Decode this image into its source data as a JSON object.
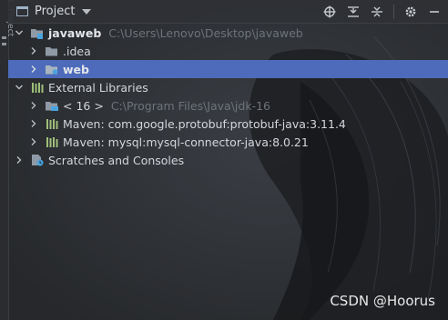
{
  "side_panel": {
    "label": "1: Project"
  },
  "toolbar": {
    "title": "Project",
    "icons": [
      "locate-icon",
      "expand-all-icon",
      "collapse-all-icon",
      "gear-icon",
      "minimize-icon"
    ]
  },
  "tree": {
    "project_root": {
      "name": "javaweb",
      "path": "C:\\Users\\Lenovo\\Desktop\\javaweb"
    },
    "idea_folder": {
      "name": ".idea"
    },
    "web_folder": {
      "name": "web"
    },
    "external_libraries": {
      "name": "External Libraries"
    },
    "jdk": {
      "name": "< 16 >",
      "path": "C:\\Program Files\\Java\\jdk-16"
    },
    "maven_protobuf": {
      "name": "Maven: com.google.protobuf:protobuf-java:3.11.4"
    },
    "maven_mysql": {
      "name": "Maven: mysql:mysql-connector-java:8.0.21"
    },
    "scratches": {
      "name": "Scratches and Consoles"
    }
  },
  "watermark": "CSDN @Hoorus",
  "colors": {
    "background": "#2b2d30",
    "selection": "#4d6bba",
    "folder": "#8f9aa6",
    "module_square": "#4aa3df",
    "path_gray": "#6e737a"
  }
}
